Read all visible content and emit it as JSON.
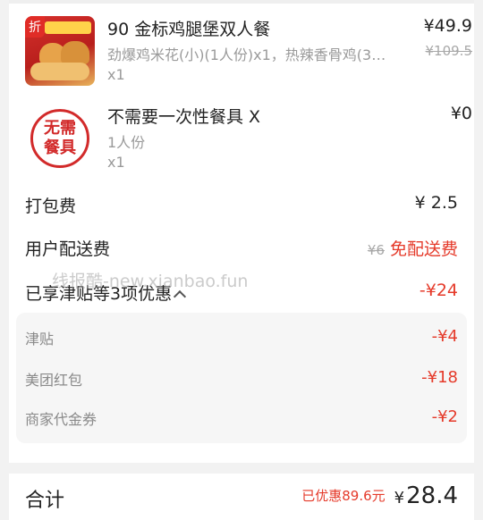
{
  "items": [
    {
      "name": "90 金标鸡腿堡双人餐",
      "desc": "劲爆鸡米花(小)(1人份)x1，热辣香骨鸡(3…",
      "qty": "x1",
      "price": "¥49.9",
      "orig_price": "¥109.5",
      "thumb_badge": "折"
    },
    {
      "name": "不需要一次性餐具 X",
      "desc": "1人份",
      "qty": "x1",
      "price": "¥0",
      "thumb_text_line1": "无需",
      "thumb_text_line2": "餐具"
    }
  ],
  "fees": {
    "packing_label": "打包费",
    "packing_value": "¥ 2.5",
    "delivery_label": "用户配送费",
    "delivery_orig": "¥6",
    "delivery_value": "免配送费",
    "discount_label": "已享津贴等3项优惠",
    "discount_value": "-¥24"
  },
  "discounts": [
    {
      "label": "津贴",
      "value": "-¥4"
    },
    {
      "label": "美团红包",
      "value": "-¥18"
    },
    {
      "label": "商家代金券",
      "value": "-¥2"
    }
  ],
  "total": {
    "label": "合计",
    "saved": "已优惠89.6元",
    "currency": "¥",
    "amount": "28.4"
  },
  "watermark": "线报酷-new.xianbao.fun",
  "colors": {
    "accent_red": "#e53a2a",
    "muted_text": "#9a9a9a"
  }
}
